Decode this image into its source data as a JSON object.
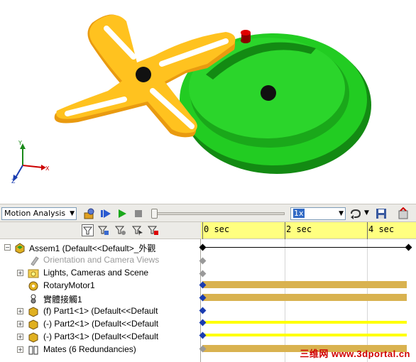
{
  "toolbar": {
    "study_type": "Motion Analysis",
    "playback_speed": "1x"
  },
  "tree": {
    "root": "Assem1  (Default<<Default>_外觀",
    "items": [
      {
        "label": "Orientation and Camera Views",
        "grayed": true
      },
      {
        "label": "Lights, Cameras and Scene"
      },
      {
        "label": "RotaryMotor1"
      },
      {
        "label": "實體接觸1"
      },
      {
        "label": "(f) Part1<1> (Default<<Default"
      },
      {
        "label": "(-) Part2<1> (Default<<Default"
      },
      {
        "label": "(-) Part3<1> (Default<<Default"
      },
      {
        "label": "Mates (6 Redundancies)"
      }
    ]
  },
  "timeline": {
    "ticks": [
      "0 sec",
      "2 sec",
      "4 sec"
    ],
    "duration_sec": 5
  },
  "watermark": "三维网 www.3dportal.cn",
  "colors": {
    "gold": "#f5b21e",
    "green": "#22cc22",
    "ruler": "#ffff80",
    "key": "#1a3cb0"
  }
}
